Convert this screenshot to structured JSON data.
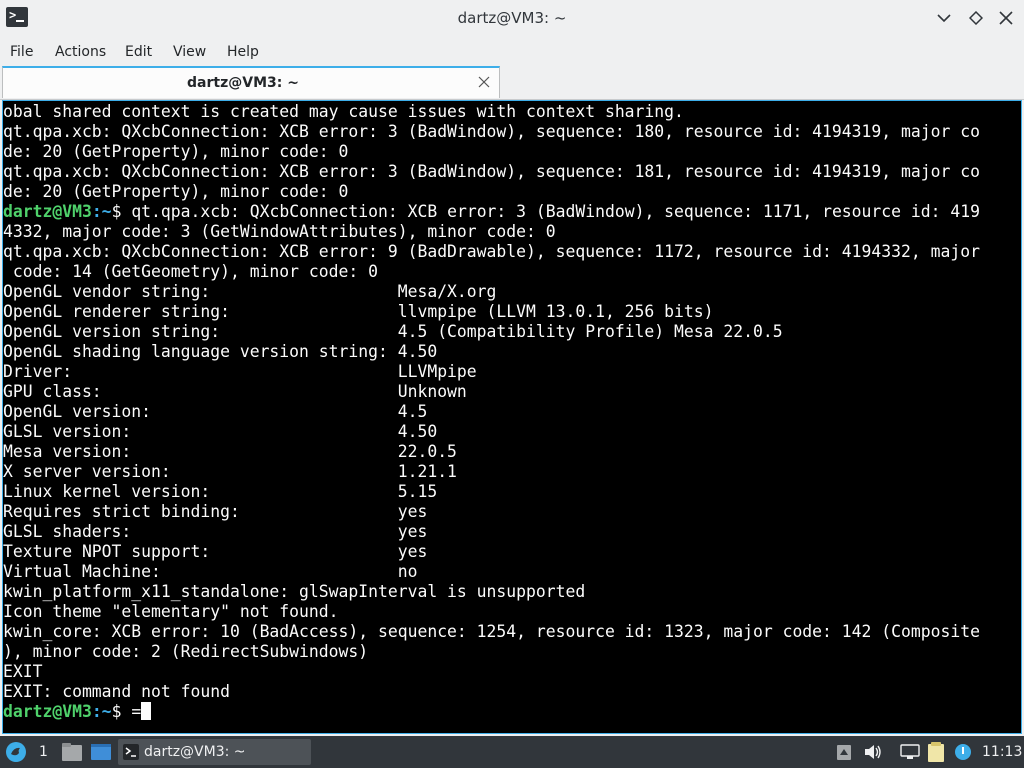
{
  "window": {
    "title": "dartz@VM3: ~"
  },
  "menu": {
    "items": [
      "File",
      "Actions",
      "Edit",
      "View",
      "Help"
    ]
  },
  "tab": {
    "title": "dartz@VM3: ~"
  },
  "terminal": {
    "lines": [
      "obal shared context is created may cause issues with context sharing.",
      "qt.qpa.xcb: QXcbConnection: XCB error: 3 (BadWindow), sequence: 180, resource id: 4194319, major co",
      "de: 20 (GetProperty), minor code: 0",
      "qt.qpa.xcb: QXcbConnection: XCB error: 3 (BadWindow), sequence: 181, resource id: 4194319, major co",
      "de: 20 (GetProperty), minor code: 0",
      {
        "prompt": true,
        "user": "dartz@VM3",
        "path": ":~",
        "symbol": "$ ",
        "text": "qt.qpa.xcb: QXcbConnection: XCB error: 3 (BadWindow), sequence: 1171, resource id: 419"
      },
      "4332, major code: 3 (GetWindowAttributes), minor code: 0",
      "qt.qpa.xcb: QXcbConnection: XCB error: 9 (BadDrawable), sequence: 1172, resource id: 4194332, major",
      " code: 14 (GetGeometry), minor code: 0",
      "OpenGL vendor string:                   Mesa/X.org",
      "OpenGL renderer string:                 llvmpipe (LLVM 13.0.1, 256 bits)",
      "OpenGL version string:                  4.5 (Compatibility Profile) Mesa 22.0.5",
      "OpenGL shading language version string: 4.50",
      "Driver:                                 LLVMpipe",
      "GPU class:                              Unknown",
      "OpenGL version:                         4.5",
      "GLSL version:                           4.50",
      "Mesa version:                           22.0.5",
      "X server version:                       1.21.1",
      "Linux kernel version:                   5.15",
      "Requires strict binding:                yes",
      "GLSL shaders:                           yes",
      "Texture NPOT support:                   yes",
      "Virtual Machine:                        no",
      "kwin_platform_x11_standalone: glSwapInterval is unsupported",
      "Icon theme \"elementary\" not found.",
      "kwin_core: XCB error: 10 (BadAccess), sequence: 1254, resource id: 1323, major code: 142 (Composite",
      "), minor code: 2 (RedirectSubwindows)",
      "EXIT",
      "EXIT: command not found",
      {
        "prompt": true,
        "user": "dartz@VM3",
        "path": ":~",
        "symbol": "$ ",
        "text": "=",
        "cursor": true
      }
    ]
  },
  "taskbar": {
    "desktop_number": "1",
    "task_label": "dartz@VM3: ~",
    "clock": "11:13"
  },
  "colors": {
    "accent": "#3daee9",
    "prompt_user": "#4fd26b",
    "terminal_bg": "#000000",
    "panel_bg": "#31363b"
  }
}
